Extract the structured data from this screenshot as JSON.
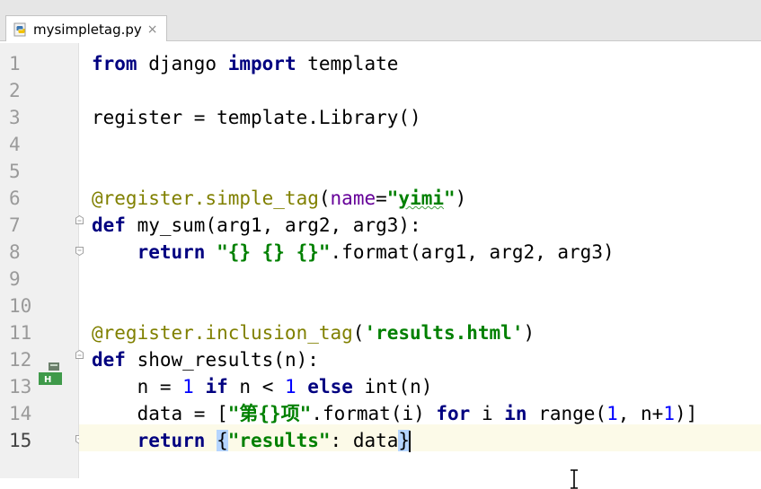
{
  "tab": {
    "filename": "mysimpletag.py",
    "close": "×"
  },
  "gutter": {
    "numbers": [
      "1",
      "2",
      "3",
      "4",
      "5",
      "6",
      "7",
      "8",
      "9",
      "10",
      "11",
      "12",
      "13",
      "14",
      "15"
    ],
    "current_line": "15"
  },
  "code": {
    "l1": {
      "kw1": "from",
      "t1": " django ",
      "kw2": "import",
      "t2": " template"
    },
    "l3": {
      "t1": "register = template.Library()"
    },
    "l6": {
      "deco": "@register.simple_tag",
      "t1": "(",
      "param": "name",
      "t2": "=",
      "str1": "\"",
      "typo": "yimi",
      "str2": "\"",
      "t3": ")"
    },
    "l7": {
      "kw": "def",
      "t1": " my_sum(arg1, arg2, arg3):"
    },
    "l8": {
      "indent": "    ",
      "kw": "return",
      "t1": " ",
      "str": "\"{} {} {}\"",
      "t2": ".format(arg1, arg2, arg3)"
    },
    "l11": {
      "deco": "@register.inclusion_tag",
      "t1": "(",
      "str": "'results.html'",
      "t2": ")"
    },
    "l12": {
      "kw": "def",
      "t1": " show_results(n):"
    },
    "l13": {
      "indent": "    ",
      "t1": "n = ",
      "num1": "1",
      "sp1": " ",
      "kw1": "if",
      "t2": " n < ",
      "num2": "1",
      "sp2": " ",
      "kw2": "else",
      "t3": " int(n)"
    },
    "l14": {
      "indent": "    ",
      "t1": "data = [",
      "str": "\"第{}项\"",
      "t2": ".format(i) ",
      "kw1": "for",
      "t3": " i ",
      "kw2": "in",
      "t4": " range(",
      "num1": "1",
      "t5": ", n+",
      "num2": "1",
      "t6": ")]"
    },
    "l15": {
      "indent": "    ",
      "kw": "return",
      "sp": " ",
      "br1": "{",
      "str": "\"results\"",
      "t1": ": data",
      "br2": "}"
    }
  },
  "colors": {
    "keyword": "#000080",
    "string": "#008000",
    "number": "#0000ff",
    "decorator": "#808000",
    "param": "#660099",
    "caret_line": "#fcfae8",
    "bracket_match": "#b5d5ff"
  }
}
